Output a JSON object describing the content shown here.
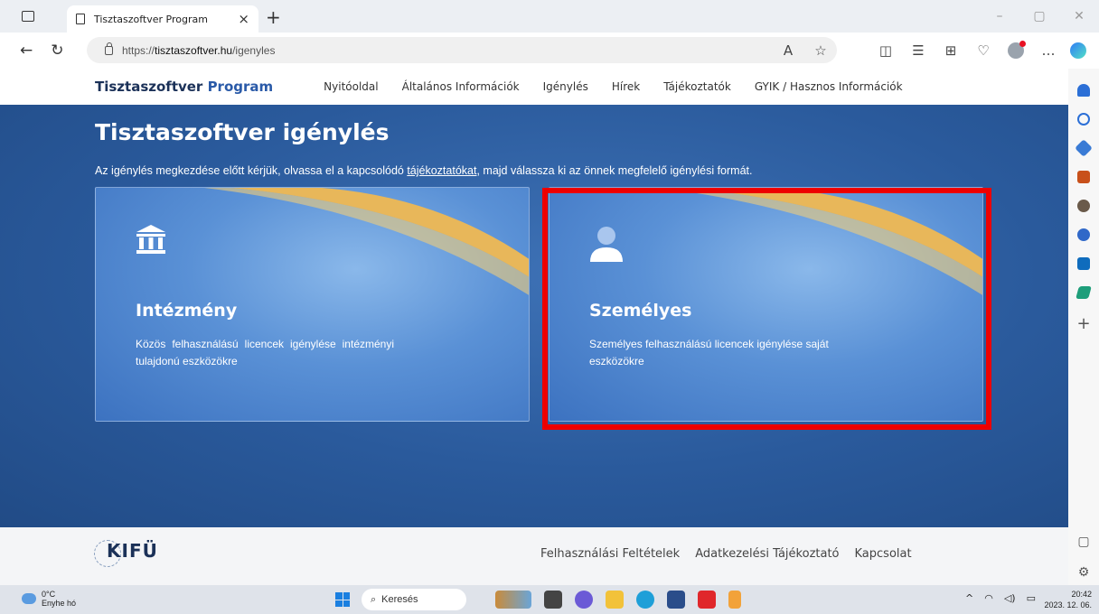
{
  "browser": {
    "tab_title": "Tisztaszoftver Program",
    "tab_close": "×",
    "new_tab": "+",
    "url_prefix": "https://",
    "url_host": "tisztaszoftver.hu",
    "url_path": "/igenyles",
    "window_controls": [
      "–",
      "▢",
      "✕"
    ]
  },
  "site": {
    "brand_part1": "Tisztaszoftver ",
    "brand_part2": "Program",
    "menu": [
      "Nyitóoldal",
      "Általános Információk",
      "Igénylés",
      "Hírek",
      "Tájékoztatók",
      "GYIK / Hasznos Információk"
    ],
    "page_title": "Tisztaszoftver igénylés",
    "lead_before": "Az igénylés megkezdése előtt kérjük, olvassa el a kapcsolódó ",
    "lead_link": "tájékoztatókat",
    "lead_after": ", majd válassza ki az önnek megfelelő igénylési formát.",
    "cards": [
      {
        "title": "Intézmény",
        "desc": "Közös felhasználású licencek igénylése intézményi tulajdonú eszközökre",
        "icon": "institution-icon"
      },
      {
        "title": "Személyes",
        "desc": "Személyes felhasználású licencek igénylése saját eszközökre",
        "icon": "person-icon"
      }
    ],
    "footer": {
      "logo": "KIFÜ",
      "links": [
        "Felhasználási Feltételek",
        "Adatkezelési Tájékoztató",
        "Kapcsolat"
      ]
    }
  },
  "taskbar": {
    "temperature": "0°C",
    "weather": "Enyhe hó",
    "search_label": "Keresés",
    "time": "20:42",
    "date": "2023. 12. 06."
  },
  "colors": {
    "hero_bg": "#2a5a9c",
    "brand_text": "#1b3158",
    "highlight": "#ee0000",
    "swoosh": "#e8b75a"
  }
}
